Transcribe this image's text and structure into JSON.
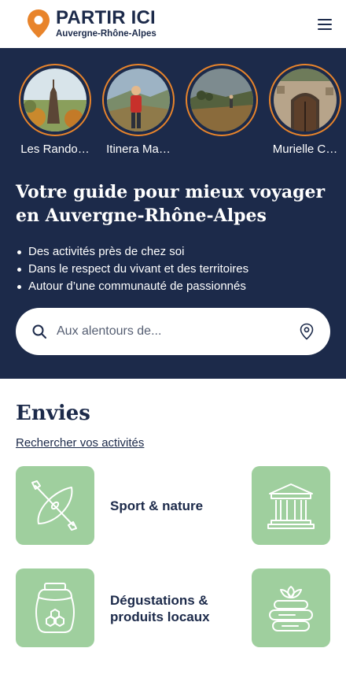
{
  "header": {
    "logo_title": "PARTIR ICI",
    "logo_subtitle": "Auvergne-Rhône-Alpes",
    "menu_icon": "hamburger-menu-icon"
  },
  "colors": {
    "navy": "#1c2a4a",
    "accent_orange": "#e8842b",
    "tile_green": "#9fcf9e",
    "white": "#ffffff"
  },
  "stories": [
    {
      "label": "Les Rando…"
    },
    {
      "label": "Itinera Ma…"
    },
    {
      "label": ""
    },
    {
      "label": "Murielle C…"
    }
  ],
  "hero": {
    "title": "Votre guide pour mieux voyager en Auvergne-Rhône-Alpes",
    "bullets": [
      "Des activités près de chez soi",
      "Dans le respect du vivant et des territoires",
      "Autour d’une communauté de passionnés"
    ]
  },
  "search": {
    "placeholder": "Aux alentours de...",
    "value": "",
    "search_icon": "search-icon",
    "locate_icon": "location-pin-icon"
  },
  "envies": {
    "title": "Envies",
    "link": "Rechercher vos activités",
    "tiles": [
      {
        "label": "Sport & nature",
        "icon": "kayak-icon"
      },
      {
        "label": "",
        "icon": "temple-icon"
      },
      {
        "label_line1": "Dégustations &",
        "label_line2": "produits locaux",
        "icon": "honey-jar-icon"
      },
      {
        "label": "",
        "icon": "spa-stones-icon"
      }
    ]
  }
}
